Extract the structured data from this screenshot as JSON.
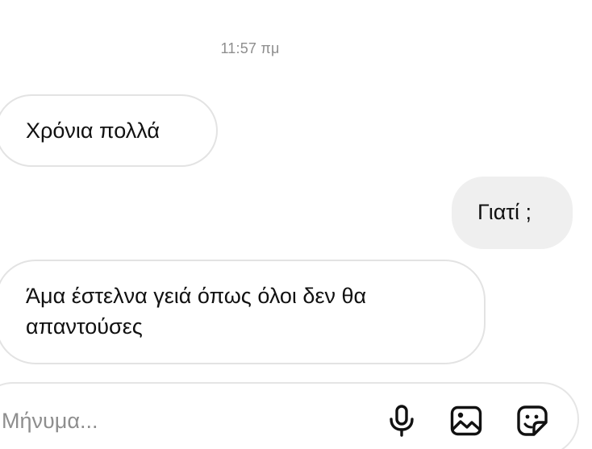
{
  "conversation": {
    "timestamp": "11:57 πμ",
    "messages": [
      {
        "direction": "incoming",
        "text": "Χρόνια πολλά"
      },
      {
        "direction": "outgoing",
        "text": "Γιατί ;"
      },
      {
        "direction": "incoming",
        "text": "Άμα έστελνα γειά όπως όλοι δεν θα απαντούσες"
      }
    ]
  },
  "composer": {
    "placeholder": "Μήνυμα...",
    "icons": {
      "mic": "microphone-icon",
      "gallery": "image-gallery-icon",
      "sticker": "sticker-icon"
    }
  },
  "colors": {
    "incoming_border": "#e3e3e3",
    "outgoing_bg": "#efefef",
    "timestamp": "#8e8e8e",
    "text": "#111111"
  }
}
